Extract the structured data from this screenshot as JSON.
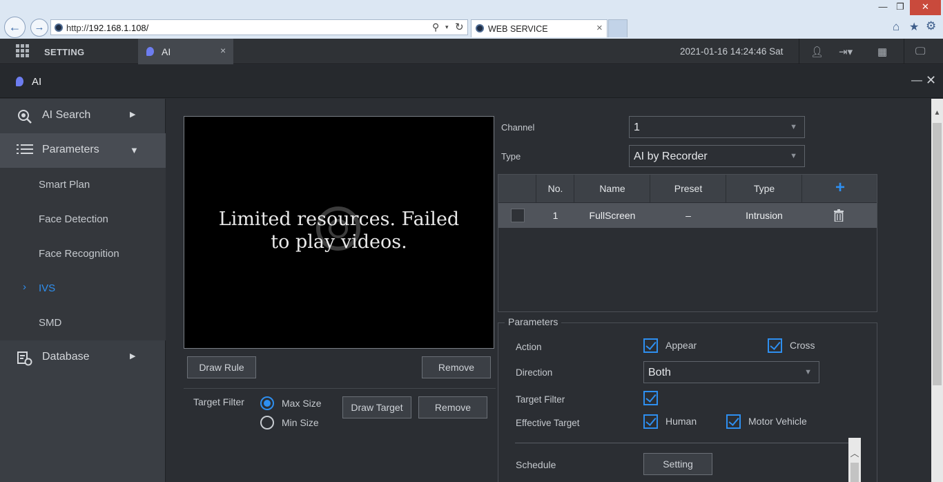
{
  "browser": {
    "url_prefix": "http://",
    "url_host": "192.168.1.108/",
    "tab_title": "WEB SERVICE",
    "tab_close": "×"
  },
  "app_bar": {
    "setting_label": "SETTING",
    "tab_label": "AI",
    "tab_close": "×",
    "datetime": "2021-01-16 14:24:46 Sat"
  },
  "window": {
    "title": "AI",
    "minimize": "—",
    "close": "✕"
  },
  "sidebar": {
    "ai_search": "AI Search",
    "parameters": "Parameters",
    "sub_items": [
      "Smart Plan",
      "Face Detection",
      "Face Recognition",
      "IVS",
      "SMD"
    ],
    "database": "Database",
    "active_item": "IVS",
    "ivs_marker": "›"
  },
  "video": {
    "message_line1": "Limited resources. Failed",
    "message_line2": "to play videos."
  },
  "buttons": {
    "draw_rule": "Draw Rule",
    "remove_rule": "Remove",
    "draw_target": "Draw Target",
    "remove_target": "Remove",
    "schedule_setting": "Setting"
  },
  "target_filter": {
    "label": "Target Filter",
    "options": [
      "Max Size",
      "Min Size"
    ],
    "selected": "Max Size"
  },
  "form": {
    "channel_label": "Channel",
    "channel_value": "1",
    "type_label": "Type",
    "type_value": "AI by Recorder"
  },
  "table": {
    "headers": [
      "No.",
      "Name",
      "Preset",
      "Type"
    ],
    "add_symbol": "+",
    "rows": [
      {
        "no": "1",
        "name": "FullScreen",
        "preset": "–",
        "type": "Intrusion",
        "checked": false
      }
    ]
  },
  "parameters": {
    "legend": "Parameters",
    "action_label": "Action",
    "action_options": [
      {
        "label": "Appear",
        "checked": true
      },
      {
        "label": "Cross",
        "checked": true
      }
    ],
    "direction_label": "Direction",
    "direction_value": "Both",
    "target_filter_label": "Target Filter",
    "target_filter_checked": true,
    "effective_target_label": "Effective Target",
    "effective_targets": [
      {
        "label": "Human",
        "checked": true
      },
      {
        "label": "Motor Vehicle",
        "checked": true
      }
    ],
    "schedule_label": "Schedule"
  },
  "colors": {
    "accent": "#2e8ff0",
    "background": "#2b2e33",
    "sidebar": "#3a3e44"
  }
}
